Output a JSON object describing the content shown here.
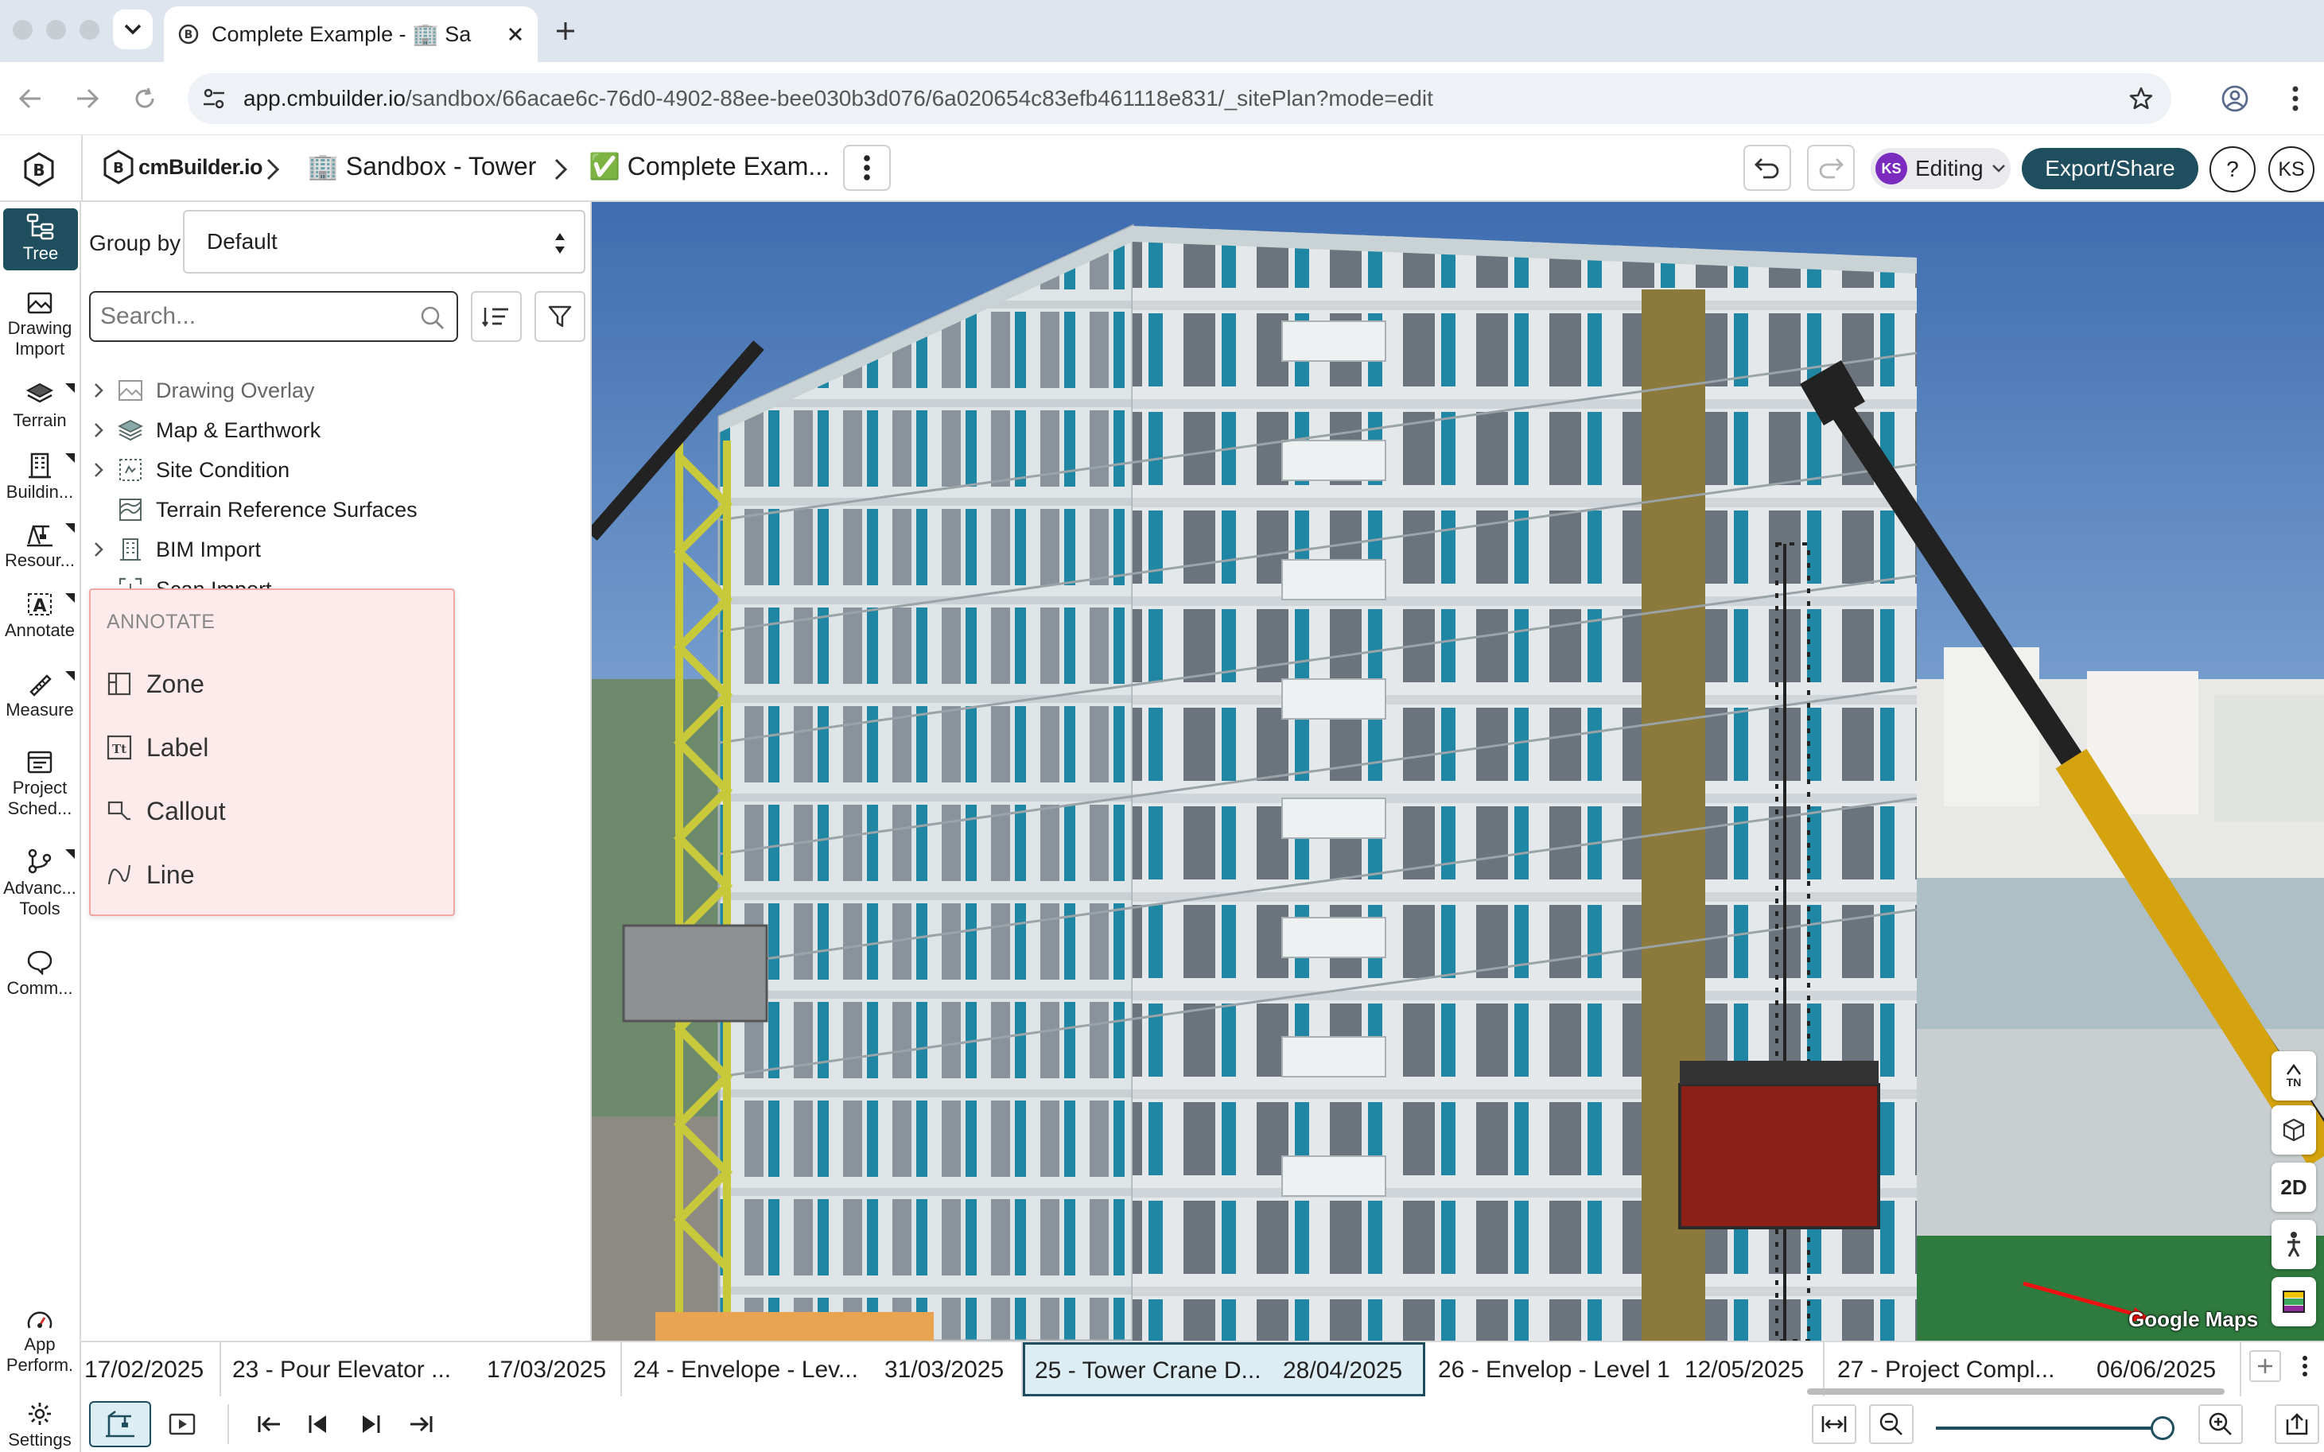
{
  "browser": {
    "tab_title": "Complete Example - 🏢 Sa",
    "url_host": "app.cmbuilder.io",
    "url_path": "/sandbox/66acae6c-76d0-4902-88ee-bee030b3d076/6a020654c83efb461118e831/_sitePlan?mode=edit"
  },
  "header": {
    "logo_text": "cmBuilder.io",
    "breadcrumb_project": "🏢 Sandbox - Tower",
    "breadcrumb_plan": "✅ Complete Exam...",
    "editing_avatar": "KS",
    "editing_label": "Editing",
    "export_label": "Export/Share",
    "help_label": "?",
    "user_initials": "KS"
  },
  "rail": {
    "tree": "Tree",
    "drawing_import_1": "Drawing",
    "drawing_import_2": "Import",
    "terrain": "Terrain",
    "building": "Buildin...",
    "resources": "Resour...",
    "annotate": "Annotate",
    "measure": "Measure",
    "schedule_1": "Project",
    "schedule_2": "Sched...",
    "advanced_1": "Advanc...",
    "advanced_2": "Tools",
    "comments": "Comm...",
    "perf_1": "App",
    "perf_2": "Perform.",
    "settings": "Settings"
  },
  "panel": {
    "groupby_label": "Group by",
    "groupby_value": "Default",
    "search_placeholder": "Search...",
    "tree": [
      {
        "label": "Drawing Overlay"
      },
      {
        "label": "Map & Earthwork"
      },
      {
        "label": "Site Condition"
      },
      {
        "label": "Terrain Reference Surfaces"
      },
      {
        "label": "BIM Import"
      },
      {
        "label": "Scan Import"
      }
    ]
  },
  "annotate_menu": {
    "heading": "ANNOTATE",
    "items": [
      {
        "label": "Zone"
      },
      {
        "label": "Label"
      },
      {
        "label": "Callout"
      },
      {
        "label": "Line"
      }
    ]
  },
  "viewport": {
    "north_label": "TN",
    "mode_2d": "2D",
    "attribution": "Google Maps"
  },
  "timeline": {
    "segments": [
      {
        "date": "17/02/2025"
      },
      {
        "title": "23 - Pour Elevator ...",
        "date": "17/03/2025"
      },
      {
        "title": "24 - Envelope - Lev...",
        "date": "31/03/2025"
      },
      {
        "title": "25 - Tower Crane D...",
        "date": "28/04/2025"
      },
      {
        "title": "26 - Envelop - Level 1",
        "date": "12/05/2025"
      },
      {
        "title": "27 - Project Compl...",
        "date": "06/06/2025"
      }
    ],
    "zoom_level": 0.95
  },
  "colors": {
    "accent": "#1f4e5f",
    "annotate_bg": "#fdeaea",
    "annotate_border": "#f2a5a5",
    "avatar": "#7b2cbf"
  }
}
